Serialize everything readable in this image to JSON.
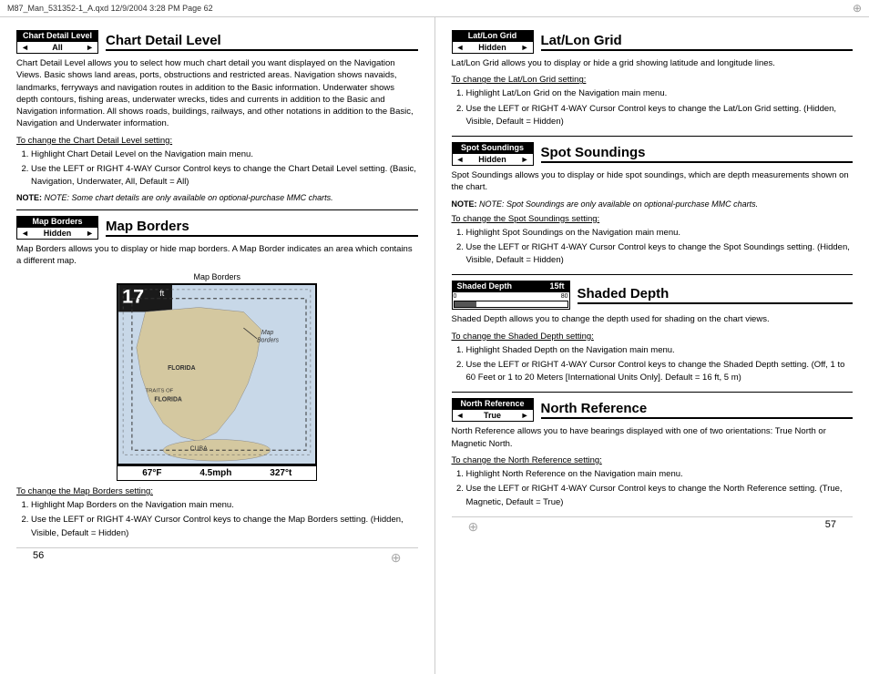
{
  "topbar": {
    "text": "M87_Man_531352-1_A.qxd   12/9/2004   3:28 PM   Page 62"
  },
  "left": {
    "page_number": "56",
    "sections": [
      {
        "id": "chart-detail-level",
        "widget_label": "Chart Detail Level",
        "widget_value": "All",
        "title": "Chart Detail Level",
        "body": "Chart Detail Level allows you to select how much chart detail you want displayed on the Navigation Views. Basic shows land areas, ports, obstructions and restricted areas. Navigation shows navaids, landmarks, ferryways and navigation routes in addition to the Basic information. Underwater shows depth contours, fishing areas, underwater wrecks, tides and currents in addition to the Basic and Navigation information. All shows roads, buildings, railways, and other notations in addition to the Basic, Navigation and Underwater information.",
        "change_heading": "To change the Chart Detail Level setting:",
        "steps": [
          "Highlight Chart Detail Level on the Navigation main menu.",
          "Use the LEFT or RIGHT 4-WAY Cursor Control keys to change the Chart Detail Level setting. (Basic, Navigation, Underwater, All, Default = All)"
        ],
        "note": "NOTE: Some chart details are only available on optional-purchase MMC charts."
      },
      {
        "id": "map-borders",
        "widget_label": "Map Borders",
        "widget_value": "Hidden",
        "title": "Map Borders",
        "body": "Map Borders allows you to display or hide map borders. A Map Border indicates an area which contains a different map.",
        "map_label": "Map Borders",
        "map_annotation": "Map\nBorders",
        "map_stats": [
          "67°F",
          "4.5mph",
          "327°t"
        ],
        "change_heading": "To change the Map Borders setting:",
        "steps": [
          "Highlight Map Borders on the Navigation main menu.",
          "Use the LEFT or RIGHT 4-WAY Cursor Control keys to change the Map Borders setting. (Hidden, Visible, Default = Hidden)"
        ]
      }
    ]
  },
  "right": {
    "page_number": "57",
    "sections": [
      {
        "id": "lat-lon-grid",
        "widget_label": "Lat/Lon Grid",
        "widget_value": "Hidden",
        "title": "Lat/Lon Grid",
        "body": "Lat/Lon Grid allows you to display or hide a grid showing latitude and longitude lines.",
        "change_heading": "To change the Lat/Lon Grid setting:",
        "steps": [
          "Highlight Lat/Lon Grid on the Navigation main menu.",
          "Use the LEFT or RIGHT 4-WAY Cursor Control keys to change the Lat/Lon Grid setting. (Hidden, Visible, Default = Hidden)"
        ]
      },
      {
        "id": "spot-soundings",
        "widget_label": "Spot  Soundings",
        "widget_value": "Hidden",
        "title": "Spot Soundings",
        "body": "Spot Soundings allows you to display or hide spot soundings, which are depth measurements shown on the chart.",
        "note": "NOTE: Spot Soundings are only available on optional-purchase MMC charts.",
        "change_heading": "To change the Spot Soundings setting:",
        "steps": [
          "Highlight Spot Soundings on the Navigation main menu.",
          "Use the LEFT or RIGHT 4-WAY Cursor Control keys to change the Spot Soundings setting. (Hidden, Visible, Default = Hidden)"
        ]
      },
      {
        "id": "shaded-depth",
        "widget_label": "Shaded Depth",
        "widget_value_left": "0",
        "widget_value_right": "15ft",
        "widget_slider_max": "80",
        "title": "Shaded Depth",
        "body": "Shaded Depth allows you to change the depth used for shading on the chart views.",
        "change_heading": "To change the Shaded Depth setting:",
        "steps": [
          "Highlight Shaded Depth on the Navigation main menu.",
          "Use the LEFT or RIGHT 4-WAY Cursor Control keys to change the Shaded Depth setting. (Off, 1 to 60 Feet or 1 to 20 Meters [International Units Only]. Default = 16 ft, 5 m)"
        ]
      },
      {
        "id": "north-reference",
        "widget_label": "North Reference",
        "widget_value": "True",
        "title": "North Reference",
        "body": "North Reference allows you to have bearings displayed with one of two orientations: True North or Magnetic North.",
        "change_heading": "To change the North Reference setting:",
        "steps": [
          "Highlight North Reference on the Navigation main menu.",
          "Use the LEFT or RIGHT 4-WAY Cursor Control keys to change the North Reference setting. (True, Magnetic, Default = True)"
        ]
      }
    ]
  }
}
